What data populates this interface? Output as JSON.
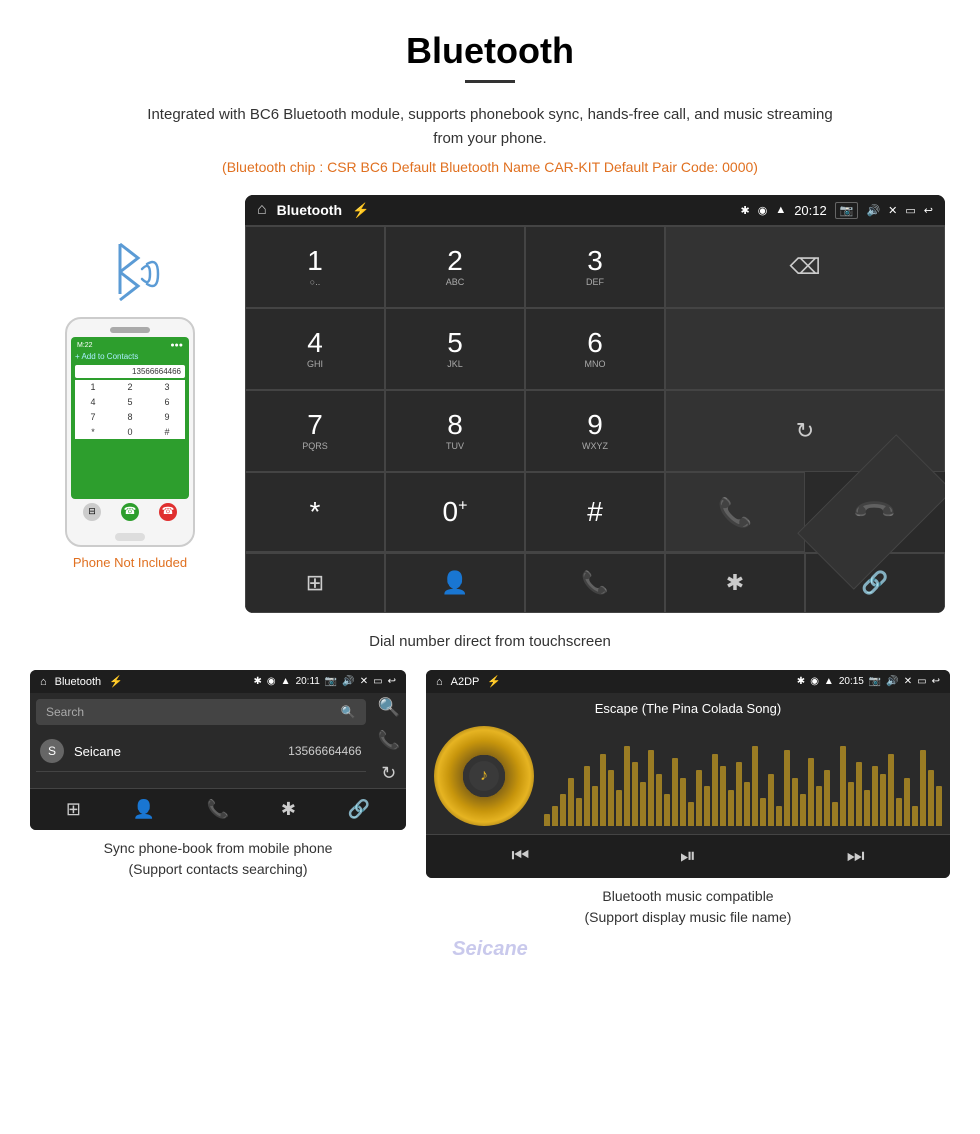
{
  "page": {
    "title": "Bluetooth",
    "description": "Integrated with BC6 Bluetooth module, supports phonebook sync, hands-free call, and music streaming from your phone.",
    "specs_line": "(Bluetooth chip : CSR BC6   Default Bluetooth Name CAR-KIT    Default Pair Code: 0000)",
    "phone_not_included": "Phone Not Included",
    "dial_caption": "Dial number direct from touchscreen"
  },
  "dialpad_screen": {
    "title": "Bluetooth",
    "time": "20:12",
    "keys": [
      {
        "number": "1",
        "letters": "○."
      },
      {
        "number": "2",
        "letters": "ABC"
      },
      {
        "number": "3",
        "letters": "DEF"
      },
      {
        "number": "4",
        "letters": "GHI"
      },
      {
        "number": "5",
        "letters": "JKL"
      },
      {
        "number": "6",
        "letters": "MNO"
      },
      {
        "number": "7",
        "letters": "PQRS"
      },
      {
        "number": "8",
        "letters": "TUV"
      },
      {
        "number": "9",
        "letters": "WXYZ"
      },
      {
        "number": "*",
        "letters": ""
      },
      {
        "number": "0",
        "letters": "+"
      },
      {
        "number": "#",
        "letters": ""
      }
    ]
  },
  "phonebook_screen": {
    "title": "Bluetooth",
    "time": "20:11",
    "search_placeholder": "Search",
    "contact": {
      "letter": "S",
      "name": "Seicane",
      "number": "13566664466"
    },
    "caption_line1": "Sync phone-book from mobile phone",
    "caption_line2": "(Support contacts searching)"
  },
  "music_screen": {
    "title": "A2DP",
    "time": "20:15",
    "song_title": "Escape (The Pina Colada Song)",
    "caption_line1": "Bluetooth music compatible",
    "caption_line2": "(Support display music file name)"
  },
  "viz_bars": [
    3,
    5,
    8,
    12,
    7,
    15,
    10,
    18,
    14,
    9,
    20,
    16,
    11,
    19,
    13,
    8,
    17,
    12,
    6,
    14,
    10,
    18,
    15,
    9,
    16,
    11,
    20,
    7,
    13,
    5,
    19,
    12,
    8,
    17,
    10,
    14,
    6,
    20,
    11,
    16,
    9,
    15,
    13,
    18,
    7,
    12,
    5,
    19,
    14,
    10
  ]
}
